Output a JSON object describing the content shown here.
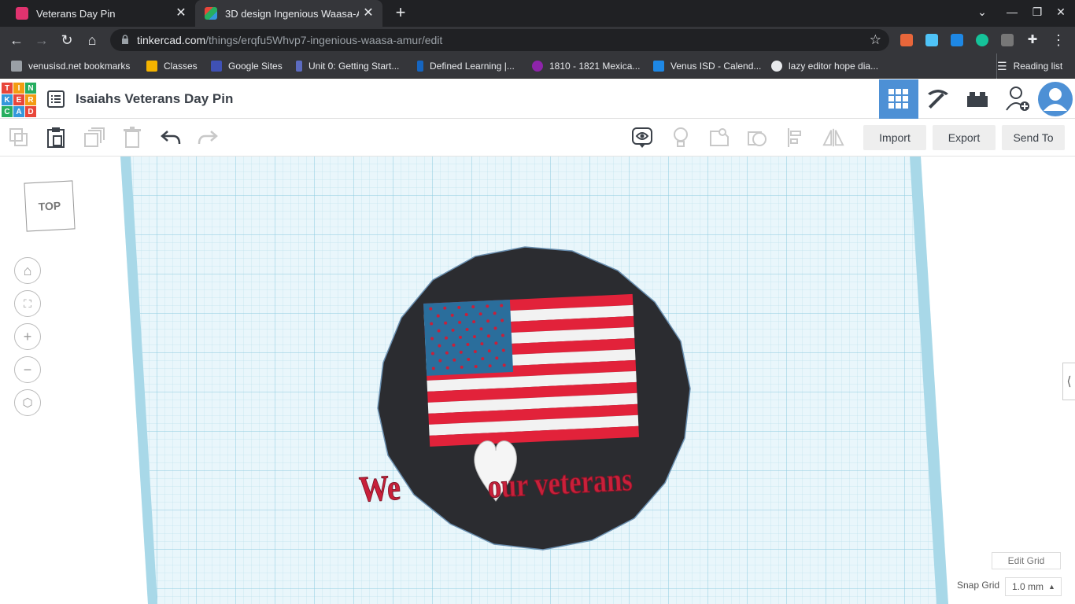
{
  "browser": {
    "tabs": [
      {
        "title": "Veterans Day Pin",
        "favicon_color": "#e0336f"
      },
      {
        "title": "3D design Ingenious Waasa-Am",
        "favicon_color": "#4aa3df"
      }
    ],
    "url_host": "tinkercad.com",
    "url_path": "/things/erqfu5Whvp7-ingenious-waasa-amur/edit",
    "bookmarks": [
      {
        "label": "venusisd.net bookmarks",
        "color": "#9aa0a6"
      },
      {
        "label": "Classes",
        "color": "#f4b400"
      },
      {
        "label": "Google Sites",
        "color": "#3f51b5"
      },
      {
        "label": "Unit 0: Getting Start...",
        "color": "#5c6bc0"
      },
      {
        "label": "Defined Learning |...",
        "color": "#1565c0"
      },
      {
        "label": "1810 - 1821 Mexica...",
        "color": "#8e24aa"
      },
      {
        "label": "Venus ISD - Calend...",
        "color": "#1e88e5"
      },
      {
        "label": "lazy editor hope dia...",
        "color": "#e8eaed"
      }
    ],
    "reading_list": "Reading list"
  },
  "app": {
    "logo_letters": [
      "T",
      "I",
      "N",
      "K",
      "E",
      "R",
      "C",
      "A",
      "D"
    ],
    "logo_colors": [
      "#e8463a",
      "#f39c12",
      "#27ae60",
      "#3498db",
      "#e8463a",
      "#f39c12",
      "#27ae60",
      "#3498db",
      "#e8463a"
    ],
    "design_title": "Isaiahs Veterans Day Pin",
    "accent": "#4d90d5"
  },
  "toolbar": {
    "import_label": "Import",
    "export_label": "Export",
    "sendto_label": "Send To"
  },
  "workplane": {
    "viewcube_label": "TOP",
    "edit_grid_label": "Edit Grid",
    "snap_grid_label": "Snap Grid",
    "snap_grid_value": "1.0 mm",
    "grid_color": "#a8d8e8",
    "pin_color": "#2b2c30"
  },
  "model": {
    "text_left": "We",
    "text_right": "our veterans",
    "text_color": "#c8203a",
    "stripe_red": "#e2223a",
    "stripe_white": "#f2f2f2",
    "canton_color": "#2a6e9c",
    "heart_color": "#f5f5f5"
  }
}
